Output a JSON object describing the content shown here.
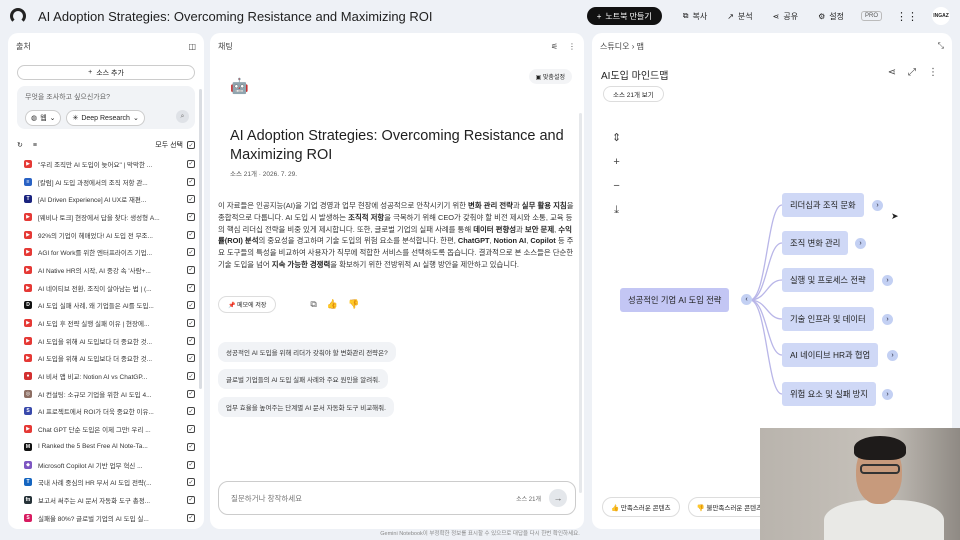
{
  "app": {
    "title": "AI Adoption Strategies: Overcoming Resistance and Maximizing ROI",
    "new_notebook": "노트북 만들기",
    "copy": "복사",
    "analytics": "분석",
    "share": "공유",
    "settings": "설정",
    "pro_badge": "PRO",
    "avatar_text": "INGAZ"
  },
  "sources": {
    "header": "출처",
    "add_source": "소스 추가",
    "search_placeholder": "무엇을 조사하고 싶으신가요?",
    "chip_web": "웹",
    "chip_research": "Deep Research",
    "select_all": "모두 선택",
    "items": [
      {
        "label": "\"우리 조직만 AI 도입이 늦어요\" | 막막한 ...",
        "icon": "youtube",
        "color": "#e53935"
      },
      {
        "label": "[칼럼] AI 도입 과정에서의 조직 저항 관...",
        "icon": "news",
        "color": "#2962c4"
      },
      {
        "label": "[AI Driven Experience] AI UX로 재편...",
        "icon": "doc",
        "color": "#1a237e"
      },
      {
        "label": "[웨비나 토크] 현장에서 답을 찾다: 생성형 A...",
        "icon": "youtube",
        "color": "#e53935"
      },
      {
        "label": "92%의 기업이 헤매었다! AI 도입 전 무조...",
        "icon": "youtube",
        "color": "#e53935"
      },
      {
        "label": "AGI for Work를 위한 엔터프라이즈 기업...",
        "icon": "youtube",
        "color": "#e53935"
      },
      {
        "label": "AI Native HR의 시작, AI 중강 속 '사람+...",
        "icon": "youtube",
        "color": "#e53935"
      },
      {
        "label": "AI 네이티브 전환, 조직이 살아남는 법 | (...",
        "icon": "youtube",
        "color": "#e53935"
      },
      {
        "label": "AI 도입 실패 사례, 왜 기업들은 AI를 도입...",
        "icon": "d-logo",
        "color": "#111111"
      },
      {
        "label": "AI 도입 후 전략 실행 실패 이유 | 현장에...",
        "icon": "youtube",
        "color": "#e53935"
      },
      {
        "label": "AI 도입을 위해 AI 도입보다 더 중요한 것...",
        "icon": "youtube",
        "color": "#e53935"
      },
      {
        "label": "AI 도입을 위해 AI 도입보다 더 중요한 것...",
        "icon": "youtube",
        "color": "#e53935"
      },
      {
        "label": "AI 비서 앱 비교: Notion AI vs ChatGP...",
        "icon": "red-circle",
        "color": "#d32f2f"
      },
      {
        "label": "AI 컨설팅: 소규모 기업을 위한 AI 도입 4...",
        "icon": "web",
        "color": "#8d6e63"
      },
      {
        "label": "AI 프로젝트에서 ROI가 더욱 중요한 이유...",
        "icon": "s-logo",
        "color": "#3949ab"
      },
      {
        "label": "Chat GPT 단순 도입은 이제 그만! 우리 ...",
        "icon": "youtube",
        "color": "#e53935"
      },
      {
        "label": "I Ranked the 5 Best Free AI Note-Ta...",
        "icon": "m-logo",
        "color": "#111111"
      },
      {
        "label": "Microsoft Copilot AI 기반 업무 혁신 ...",
        "icon": "copilot",
        "color": "#7e57c2"
      },
      {
        "label": "국내 사례 중심의 HR 부서 AI 도입 전략(...",
        "icon": "doc",
        "color": "#1565c0"
      },
      {
        "label": "보고서 써주는 AI 문서 자동화 도구 총정...",
        "icon": "fn-logo",
        "color": "#263238"
      },
      {
        "label": "실패율 80%? 글로벌 기업의 AI 도입 실...",
        "icon": "s-logo",
        "color": "#d81b60"
      }
    ]
  },
  "chat": {
    "header": "채팅",
    "save_setting": "맞춤설정",
    "note_title": "AI Adoption Strategies: Overcoming Resistance and Maximizing ROI",
    "meta": "소스 21개 · 2026. 7. 29.",
    "summary": [
      {
        "t": "이 자료들은 인공지능(AI)을 기업 경영과 업무 현장에 성공적으로 안착시키기 위한 ",
        "b": false
      },
      {
        "t": "변화 관리 전략",
        "b": true
      },
      {
        "t": "과 ",
        "b": false
      },
      {
        "t": "실무 활용 지침",
        "b": true
      },
      {
        "t": "을 종합적으로 다룹니다. AI 도입 시 발생하는 ",
        "b": false
      },
      {
        "t": "조직적 저항",
        "b": true
      },
      {
        "t": "을 극복하기 위해 CEO가 갖춰야 할 비전 제시와 소통, 교육 등의 핵심 리더십 전략을 비중 있게 제시합니다. 또한, 글로벌 기업의 실패 사례를 통해 ",
        "b": false
      },
      {
        "t": "데이터 편향성",
        "b": true
      },
      {
        "t": "과 ",
        "b": false
      },
      {
        "t": "보안 문제",
        "b": true
      },
      {
        "t": ", ",
        "b": false
      },
      {
        "t": "수익률(ROI) 분석",
        "b": true
      },
      {
        "t": "의 중요성을 경고하며 기술 도입의 위험 요소를 분석합니다. 한편, ",
        "b": false
      },
      {
        "t": "ChatGPT",
        "b": true
      },
      {
        "t": ", ",
        "b": false
      },
      {
        "t": "Notion AI",
        "b": true
      },
      {
        "t": ", ",
        "b": false
      },
      {
        "t": "Copilot",
        "b": true
      },
      {
        "t": " 등 주요 도구들의 특성을 비교하여 사용자가 직무에 적합한 서비스를 선택하도록 돕습니다. 결과적으로 본 소스들은 단순한 기술 도입을 넘어 ",
        "b": false
      },
      {
        "t": "지속 가능한 경쟁력",
        "b": true
      },
      {
        "t": "을 확보하기 위한 전방위적 AI 실행 방안을 제안하고 있습니다.",
        "b": false
      }
    ],
    "memo_btn": "메모에 저장",
    "suggestions": [
      "성공적인 AI 도입을 위해 리더가 갖춰야 할 변화관리 전략은?",
      "글로벌 기업들의 AI 도입 실패 사례와 주요 원인을 알려줘.",
      "업무 효율을 높여주는 단계별 AI 문서 자동화 도구 비교해줘."
    ],
    "input_placeholder": "질문하거나 창작하세요",
    "source_count": "소스 21개"
  },
  "studio": {
    "breadcrumb_1": "스튜디오",
    "breadcrumb_2": "맵",
    "map_title": "AI도입 마인드맵",
    "source_view": "소스 21개 보기",
    "root": "성공적인 기업 AI 도입 전략",
    "children": [
      "리더십과 조직 문화",
      "조직 변화 관리",
      "실행 및 프로세스 전략",
      "기술 인프라 및 데이터",
      "AI 네이티브 HR과 협업",
      "위험 요소 및 실패 방지"
    ],
    "good": "만족스러운 콘텐츠",
    "bad": "불만족스러운 콘텐츠"
  },
  "footer": "Gemini Notebook이 부정확한 정보를 표시할 수 있으므로 대답을 다시 한번 확인하세요."
}
